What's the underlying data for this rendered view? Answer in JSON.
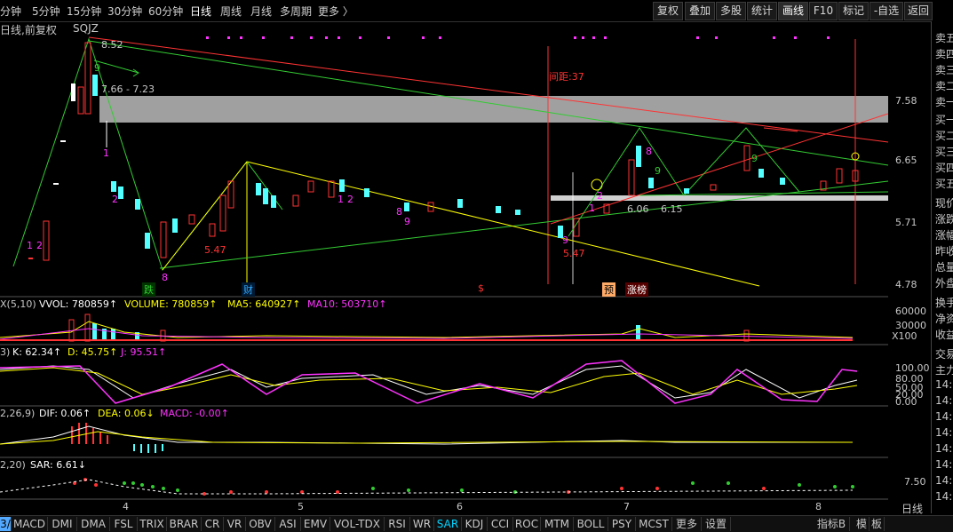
{
  "topbar": {
    "timeframes": [
      "分钟",
      "5分钟",
      "15分钟",
      "30分钟",
      "60分钟",
      "日线",
      "周线",
      "月线",
      "多周期",
      "更多 〉"
    ],
    "active_timeframe": "日线",
    "buttons": [
      "复权",
      "叠加",
      "多股",
      "统计",
      "画线",
      "F10",
      "标记",
      "-自选",
      "返回"
    ],
    "active_button": "画线"
  },
  "header": {
    "mode": "日线,前复权",
    "symbol": "SQJZ"
  },
  "price_axis": [
    "7.58",
    "6.65",
    "5.71",
    "4.78"
  ],
  "price_labels": {
    "high": "8.52",
    "range": "7.66 - 7.23",
    "gap": "间距:37",
    "low1": "5.47",
    "low2": "5.47",
    "p1": "6.06",
    "p2": "6.15"
  },
  "counts": [
    "1",
    "2",
    "9",
    "1",
    "2",
    "8",
    "1",
    "2",
    "8",
    "9",
    "9",
    "1",
    "2",
    "9",
    "8",
    "9"
  ],
  "event_tags": {
    "die": "跌",
    "cai": "财",
    "s": "$",
    "yu": "预",
    "zhangbang": "涨榜"
  },
  "volume": {
    "title": "X(5,10)",
    "vvol": "VVOL: 780859↑",
    "volume": "VOLUME: 780859↑",
    "ma5": "MA5: 640927↑",
    "ma10": "MA10: 503710↑",
    "axis": [
      "60000",
      "30000",
      "X100"
    ]
  },
  "kdj": {
    "title": "3)",
    "k": "K: 62.34↑",
    "d": "D: 45.75↑",
    "j": "J: 95.51↑",
    "axis": [
      "100.00",
      "80.00",
      "50.00",
      "20.00",
      "0.00"
    ]
  },
  "macd": {
    "title": "2,26,9)",
    "dif": "DIF: 0.06↑",
    "dea": "DEA: 0.06↓",
    "macd": "MACD: -0.00↑"
  },
  "sar": {
    "title": "2,20)",
    "value": "SAR: 6.61↓",
    "axis": [
      "7.50"
    ]
  },
  "x_axis": [
    "4",
    "5",
    "6",
    "7",
    "8"
  ],
  "right_panel": [
    "卖五",
    "卖四",
    "卖三",
    "卖二",
    "卖一",
    "买一",
    "买二",
    "买三",
    "买四",
    "买五",
    "现价",
    "涨跌",
    "涨幅",
    "昨收",
    "总量",
    "外盘",
    "换手",
    "净资",
    "收益",
    "交易",
    "主力",
    "14:",
    "14:",
    "14:",
    "14:",
    "14:",
    "14:",
    "14:",
    "14:"
  ],
  "bottom_tabs": [
    "3/",
    "MACD",
    "DMI",
    "DMA",
    "FSL",
    "TRIX",
    "BRAR",
    "CR",
    "VR",
    "OBV",
    "ASI",
    "EMV",
    "VOL-TDX",
    "RSI",
    "WR",
    "SAR",
    "KDJ",
    "CCI",
    "ROC",
    "MTM",
    "BOLL",
    "PSY",
    "MCST",
    "更多",
    "设置"
  ],
  "active_tab": "SAR",
  "bottom_right": [
    "指标B",
    "模",
    "板",
    "日线"
  ],
  "colors": {
    "up": "#ff3333",
    "down": "#54ffff",
    "yellow": "#ffff00",
    "magenta": "#ff33ff",
    "green": "#33cc33",
    "white": "#ffffff"
  }
}
